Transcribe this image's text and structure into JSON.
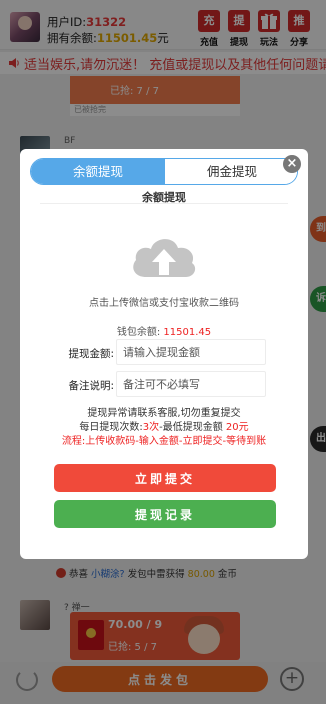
{
  "header": {
    "uid_label": "用户ID:",
    "uid_value": "31322",
    "balance_label": "拥有余额:",
    "balance_value": "11501.45",
    "balance_unit": "元",
    "buttons": [
      {
        "icon": "充",
        "label": "充值"
      },
      {
        "icon": "提",
        "label": "提现"
      },
      {
        "icon": "gift-icon",
        "label": "玩法"
      },
      {
        "icon": "推",
        "label": "分享"
      }
    ]
  },
  "marquee": {
    "text": "适当娱乐,请勿沉迷！ 充值或提现以及其他任何问题请联"
  },
  "chat": {
    "top_packet_text": "已抢: 7 / 7",
    "top_packet_tag": "已被抢完",
    "bf_name": "BF",
    "side_bubbles": [
      "到",
      "诉",
      "出"
    ],
    "notice_prefix": "恭喜",
    "notice_user": "小糊涂?",
    "notice_middle": "发包中雷获得",
    "notice_amount": "80.00",
    "notice_suffix": "金币",
    "last_sender": "? 禅一",
    "packet_amount": "70.00 / 9",
    "packet_progress": "已抢: 5 / 7"
  },
  "bottom_bar": {
    "send_label": "点击发包",
    "plus_label": "+"
  },
  "modal": {
    "close_label": "×",
    "tabs": [
      "余额提现",
      "佣金提现"
    ],
    "section_title": "余额提现",
    "upload_hint": "点击上传微信或支付宝收款二维码",
    "wallet_label": "钱包余额:",
    "wallet_value": "11501.45",
    "amount_label": "提现金额:",
    "amount_placeholder": "请输入提现金额",
    "note_label": "备注说明:",
    "note_placeholder": "备注可不必填写",
    "info_line1": "提现异常请联系客服,切勿重复提交",
    "info_line2_a": "每日提现次数:",
    "info_line2_b": "3次",
    "info_line2_c": "-最低提现金额",
    "info_line2_d": "20元",
    "info_line3": "流程:上传收款码-输入金额-立即提交-等待到账",
    "submit_label": "立即提交",
    "record_label": "提现记录"
  },
  "colors": {
    "accent_red": "#cf2b2b",
    "tab_blue": "#56a8e8",
    "submit_red": "#f04a3a",
    "record_green": "#4caf50",
    "send_orange": "#ee6a21"
  }
}
